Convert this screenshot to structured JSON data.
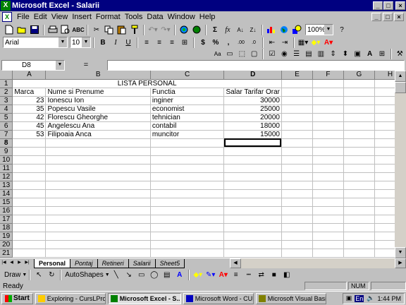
{
  "window": {
    "title": "Microsoft Excel - Salarii"
  },
  "menu": [
    "File",
    "Edit",
    "View",
    "Insert",
    "Format",
    "Tools",
    "Data",
    "Window",
    "Help"
  ],
  "toolbar": {
    "zoom": "100%",
    "font": "Arial",
    "font_size": "10"
  },
  "formula_bar": {
    "cell_ref": "D8",
    "equals": "=",
    "formula": ""
  },
  "columns": [
    "A",
    "B",
    "C",
    "D",
    "E",
    "F",
    "G",
    "H"
  ],
  "sheet": {
    "title": "LISTA PERSONAL",
    "headers": [
      "Marca",
      "Nume si Prenume",
      "Functia",
      "Salar Tarifar Orar"
    ],
    "rows": [
      {
        "marca": "23",
        "nume": "Ionescu Ion",
        "functia": "inginer",
        "salar": "30000"
      },
      {
        "marca": "35",
        "nume": "Popescu Vasile",
        "functia": "economist",
        "salar": "25000"
      },
      {
        "marca": "42",
        "nume": "Florescu Gheorghe",
        "functia": "tehnician",
        "salar": "20000"
      },
      {
        "marca": "45",
        "nume": "Angelescu Ana",
        "functia": "contabil",
        "salar": "18000"
      },
      {
        "marca": "53",
        "nume": "Filipoaia Anca",
        "functia": "muncitor",
        "salar": "15000"
      }
    ]
  },
  "sheet_tabs": [
    "Personal",
    "Pontaj",
    "Retineri",
    "Salarii",
    "Sheet5"
  ],
  "drawing": {
    "draw": "Draw",
    "autoshapes": "AutoShapes"
  },
  "status": {
    "text": "Ready",
    "num": "NUM"
  },
  "taskbar": {
    "start": "Start",
    "tasks": [
      "Exploring - CursLProg",
      "Microsoft Excel - S...",
      "Microsoft Word - CURS...",
      "Microsoft Visual Basic -..."
    ],
    "active_task": 1,
    "time": "1:44 PM"
  }
}
